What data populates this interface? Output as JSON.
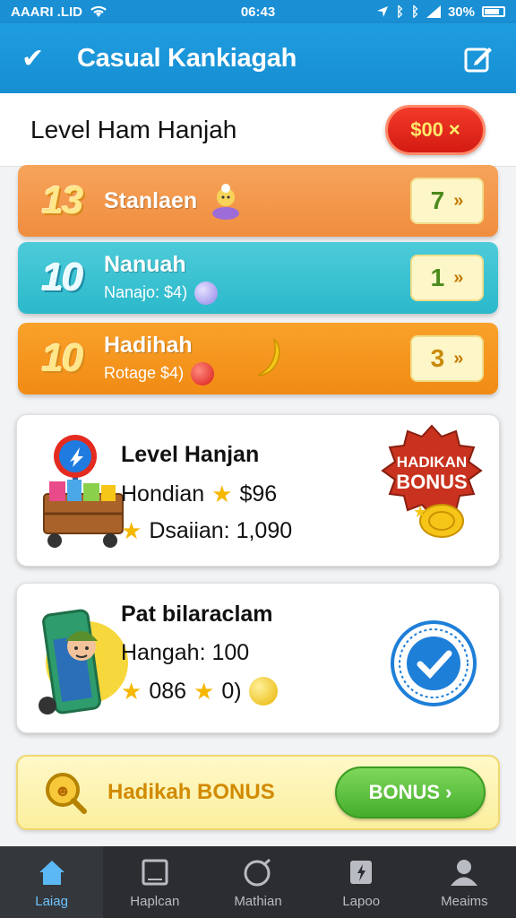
{
  "status_bar": {
    "carrier": "AAARI .LID",
    "time": "06:43",
    "battery": "30%"
  },
  "app_bar": {
    "title": "Casual Kankiagah",
    "icons": [
      "check-icon",
      "edit-icon"
    ]
  },
  "level_header": {
    "title": "Level Ham Hanjah",
    "price_label": "$00",
    "price_close": "×"
  },
  "rows": [
    {
      "num": "13",
      "title": "Stanlaen",
      "subtitle": "",
      "count": "7",
      "chevron": "»",
      "color": "#f29a4a"
    },
    {
      "num": "10",
      "title": "Nanuah",
      "subtitle": "Nanajo: $4)",
      "count": "1",
      "chevron": "»",
      "color": "#3cc2d2"
    },
    {
      "num": "10",
      "title": "Hadihah",
      "subtitle": "Rotage $4)",
      "count": "3",
      "chevron": "»",
      "color": "#f5961f"
    }
  ],
  "card1": {
    "title": "Level Hanjan",
    "line1_text": "Hondian",
    "line1_value": "$96",
    "line2_text": "Dsaiian: 1,090",
    "badge_line1": "HADIKAN",
    "badge_line2": "BONUS"
  },
  "card2": {
    "title": "Pat bilaraclam",
    "line1": "Hangah: 100",
    "line2_a": "086",
    "line2_b": "0)"
  },
  "bonus_bar": {
    "label": "Hadikah BONUS",
    "button": "BONUS",
    "button_chevron": "›"
  },
  "bottom_nav": [
    {
      "label": "Laiag",
      "icon": "home-icon",
      "active": true
    },
    {
      "label": "Haplcan",
      "icon": "tablet-icon",
      "active": false
    },
    {
      "label": "Mathian",
      "icon": "circle-icon",
      "active": false
    },
    {
      "label": "Lapoo",
      "icon": "badge-icon",
      "active": false
    },
    {
      "label": "Meaims",
      "icon": "user-icon",
      "active": false
    }
  ],
  "colors": {
    "primary": "#1a8fd4",
    "price_red": "#e02a1c",
    "bonus_green": "#4fb431",
    "nav_bg": "#2b2d30",
    "nav_active": "#6fc4ff"
  }
}
